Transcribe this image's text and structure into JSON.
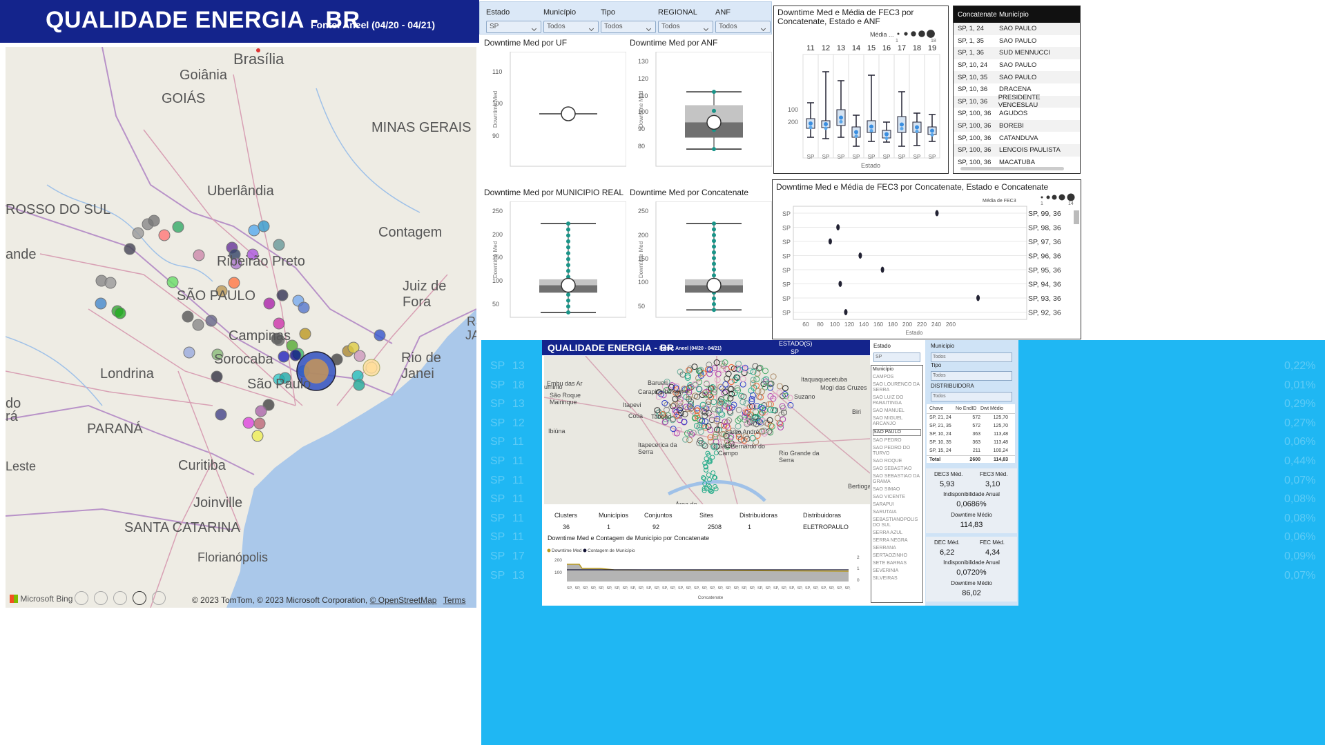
{
  "title": {
    "main": "QUALIDADE ENERGIA - BR",
    "source": "Fonte: Aneel (04/20 - 04/21)"
  },
  "map": {
    "places": [
      "Brasília",
      "Goiânia",
      "GOIÁS",
      "MINAS GERAIS",
      "Uberlândia",
      "ROSSO DO SUL",
      "Contagem",
      "ande",
      "Ribeirão Preto",
      "Juiz de Fora",
      "SÃO PAULO",
      "Campinas",
      "Sorocaba",
      "Rio de Janei",
      "Londrina",
      "São Paulo",
      "RJ",
      "do",
      "rá",
      "PARANÁ",
      "Leste",
      "Curitiba",
      "Joinville",
      "SANTA CATARINA",
      "Florianópolis",
      "JA"
    ],
    "attribution": "© 2023 TomTom, © 2023 Microsoft Corporation,",
    "osm": "© OpenStreetMap",
    "terms": "Terms",
    "brand": "Microsoft Bing"
  },
  "filters": [
    {
      "label": "Estado",
      "value": "SP"
    },
    {
      "label": "Município",
      "value": "Todos"
    },
    {
      "label": "Tipo",
      "value": "Todos"
    },
    {
      "label": "REGIONAL",
      "value": "Todos"
    },
    {
      "label": "ANF",
      "value": "Todos"
    }
  ],
  "charts": {
    "uf": {
      "title": "Downtime Med por UF",
      "ylabel": "Downtime Med",
      "ticks": [
        "110",
        "100",
        "90"
      ]
    },
    "anf": {
      "title": "Downtime Med por ANF",
      "ylabel": "Downtime Med",
      "ticks": [
        "130",
        "120",
        "110",
        "100",
        "90",
        "80"
      ]
    },
    "mun": {
      "title": "Downtime Med por MUNICIPIO REAL",
      "ylabel": "Downtime Med",
      "ticks": [
        "250",
        "200",
        "150",
        "100",
        "50"
      ]
    },
    "conc": {
      "title": "Downtime Med por Concatenate",
      "ylabel": "Downtime Med",
      "ticks": [
        "250",
        "200",
        "150",
        "100",
        "50"
      ]
    },
    "fec3": {
      "title": "Downtime Med e Média de FEC3 por Concatenate, Estado e ANF",
      "legend": "Média ...",
      "legend_nums": [
        "1",
        "18"
      ],
      "ylabel": "Downtime Med",
      "xlabel": "Estado",
      "cols": [
        "11",
        "12",
        "13",
        "14",
        "15",
        "16",
        "17",
        "18",
        "19"
      ],
      "y_ticks": [
        "200",
        "100"
      ]
    },
    "fec3b": {
      "title": "Downtime Med e Média de FEC3 por Concatenate, Estado e Concatenate",
      "legend": "Média de FEC3",
      "legend_nums": [
        "1",
        "14"
      ],
      "ylabel": "Downtime Med",
      "xlabel": "Estado",
      "rows": [
        "SP, 99, 36",
        "SP, 98, 36",
        "SP, 97, 36",
        "SP, 96, 36",
        "SP, 95, 36",
        "SP, 94, 36",
        "SP, 93, 36",
        "SP, 92, 36"
      ],
      "x_ticks": [
        "60",
        "80",
        "100",
        "120",
        "140",
        "160",
        "180",
        "200",
        "220",
        "240",
        "260"
      ]
    }
  },
  "chart_data": [
    {
      "type": "box",
      "title": "Downtime Med por UF",
      "categories": [
        "SP"
      ],
      "median": [
        97
      ]
    },
    {
      "type": "box",
      "title": "Downtime Med por ANF",
      "ylim": [
        75,
        135
      ],
      "min": 84,
      "q1": 90,
      "median": 98,
      "q3": 107,
      "max": 114,
      "mean": 98
    },
    {
      "type": "box",
      "title": "Downtime Med por MUNICIPIO REAL",
      "min": 45,
      "q1": 80,
      "median": 100,
      "q3": 112,
      "max": 225,
      "mean": 100
    },
    {
      "type": "box",
      "title": "Downtime Med por Concatenate",
      "min": 50,
      "q1": 85,
      "median": 100,
      "q3": 112,
      "max": 225,
      "mean": 100
    },
    {
      "type": "scatter",
      "title": "Downtime Med e Média de FEC3 por Concatenate, Estado e Concatenate",
      "categories": [
        "SP, 99, 36",
        "SP, 98, 36",
        "SP, 97, 36",
        "SP, 96, 36",
        "SP, 95, 36",
        "SP, 94, 36",
        "SP, 93, 36",
        "SP, 92, 36"
      ],
      "values": [
        178,
        89,
        82,
        109,
        129,
        91,
        215,
        96
      ]
    }
  ],
  "table": {
    "headers": [
      "Concatenate",
      "Município"
    ],
    "rows": [
      [
        "SP, 1, 24",
        "SAO PAULO"
      ],
      [
        "SP, 1, 35",
        "SAO PAULO"
      ],
      [
        "SP, 1, 36",
        "SUD MENNUCCI"
      ],
      [
        "SP, 10, 24",
        "SAO PAULO"
      ],
      [
        "SP, 10, 35",
        "SAO PAULO"
      ],
      [
        "SP, 10, 36",
        "DRACENA"
      ],
      [
        "SP, 10, 36",
        "PRESIDENTE VENCESLAU"
      ],
      [
        "SP, 100, 36",
        "AGUDOS"
      ],
      [
        "SP, 100, 36",
        "BOREBI"
      ],
      [
        "SP, 100, 36",
        "CATANDUVA"
      ],
      [
        "SP, 100, 36",
        "LENCOIS PAULISTA"
      ],
      [
        "SP, 100, 36",
        "MACATUBA"
      ]
    ]
  },
  "bg_rows": [
    [
      "SP",
      "13",
      "0,22%"
    ],
    [
      "SP",
      "18",
      "0,01%"
    ],
    [
      "SP",
      "13",
      "0,29%"
    ],
    [
      "SP",
      "12",
      "0,27%"
    ],
    [
      "SP",
      "11",
      "0,06%"
    ],
    [
      "SP",
      "11",
      "0,44%"
    ],
    [
      "SP",
      "11",
      "0,07%"
    ],
    [
      "SP",
      "11",
      "0,08%"
    ],
    [
      "SP",
      "11",
      "0,08%"
    ],
    [
      "SP",
      "11",
      "0,06%"
    ],
    [
      "SP",
      "17",
      "0,09%"
    ],
    [
      "SP",
      "13",
      "0,07%"
    ]
  ],
  "inset": {
    "title": "QUALIDADE ENERGIA - BR",
    "source": "Fonte: Aneel (04/20 - 04/21)",
    "estado_label": "ESTADO(S)",
    "estado_value": "SP",
    "map_places": [
      "Barueri",
      "Carapicuíba",
      "Osasco",
      "Itaquaquecetuba",
      "Mogi das Cruzes",
      "Suzano",
      "São Roque",
      "Mairinque",
      "Itapevi",
      "Cotia",
      "Taboão",
      "Embu das Ar",
      "Itapecerica da Serra",
      "Santo André",
      "São Bernardo do Campo",
      "Rio Grande da Serra",
      "Bertioga",
      "Ibiúna",
      "Biri",
      "Área de Proteção",
      "uminio"
    ],
    "mun_list": [
      "Município",
      "CAMPOS",
      "SAO LOURENCO DA SERRA",
      "SAO LUIZ DO PARAITINGA",
      "SAO MANUEL",
      "SAO MIGUEL ARCANJO",
      "SAO PAULO",
      "SAO PEDRO",
      "SAO PEDRO DO TURVO",
      "SAO ROQUE",
      "SAO SEBASTIAO",
      "SAO SEBASTIAO DA GRAMA",
      "SAO SIMAO",
      "SAO VICENTE",
      "SARAPUI",
      "SARUTAIA",
      "SEBASTIANOPOLIS DO SUL",
      "SERRA AZUL",
      "SERRA NEGRA",
      "SERRANA",
      "SERTAOZINHO",
      "SETE BARRAS",
      "SEVERINIA",
      "SILVEIRAS"
    ],
    "stats": [
      {
        "label": "Clusters",
        "value": "36"
      },
      {
        "label": "Municípios",
        "value": "1"
      },
      {
        "label": "Conjuntos",
        "value": "92"
      },
      {
        "label": "Sites",
        "value": "2508"
      },
      {
        "label": "Distribuidoras",
        "value": "1"
      },
      {
        "label": "Distribuidoras",
        "value": "ELETROPAULO"
      }
    ],
    "chart_title": "Downtime Med e Contagem de Município por Concatenate",
    "chart_legend": [
      "Downtime Med",
      "Contagem de Município"
    ],
    "chart_y": [
      "200",
      "100"
    ],
    "chart_y2": [
      "2",
      "1",
      "0"
    ],
    "chart_ylabel": "Downtime",
    "chart_y2label": "Contagem d...",
    "chart_xlabel": "Concatenate",
    "filters": [
      {
        "label": "Estado",
        "value": "SP"
      },
      {
        "label": "Município",
        "value": "Todos"
      },
      {
        "label": "Tipo",
        "value": "Todos"
      },
      {
        "label": "DISTRIBUIDORA",
        "value": "Todos"
      }
    ],
    "table": {
      "headers": [
        "Chave",
        "No EndID",
        "Dwt Médio"
      ],
      "rows": [
        [
          "SP, 21, 24",
          "572",
          "125,70"
        ],
        [
          "SP, 21, 35",
          "572",
          "125,70"
        ],
        [
          "SP, 10, 24",
          "363",
          "113,48"
        ],
        [
          "SP, 10, 35",
          "363",
          "113,48"
        ],
        [
          "SP, 15, 24",
          "211",
          "100,24"
        ]
      ],
      "total": [
        "Total",
        "2600",
        "114,83"
      ]
    },
    "kpi1": {
      "a_label": "DEC3 Méd.",
      "a": "5,93",
      "b_label": "FEC3 Méd.",
      "b": "3,10",
      "c_label": "Indisponibilidade Anual",
      "c": "0,0686%",
      "d_label": "Downtime Médio",
      "d": "114,83"
    },
    "kpi2": {
      "a_label": "DEC Méd.",
      "a": "6,22",
      "b_label": "FEC Méd.",
      "b": "4,34",
      "c_label": "Indisponibilidade Anual",
      "c": "0,0720%",
      "d_label": "Downtime Médio",
      "d": "86,02"
    }
  }
}
